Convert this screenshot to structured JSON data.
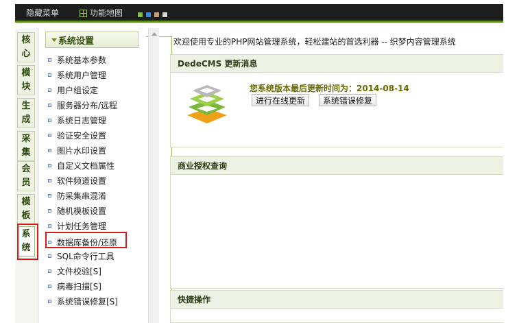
{
  "topbar": {
    "hide_menu_label": "隐藏菜单",
    "site_map_label": "功能地图",
    "skin_colors": [
      "#7bc142",
      "#3a8bd6",
      "#c8a070",
      "#d8d8d8"
    ]
  },
  "vtabs": [
    {
      "label1": "核",
      "label2": "心"
    },
    {
      "label1": "模",
      "label2": "块"
    },
    {
      "label1": "生",
      "label2": "成"
    },
    {
      "label1": "采",
      "label2": "集"
    },
    {
      "label1": "会",
      "label2": "员"
    },
    {
      "label1": "模",
      "label2": "板"
    },
    {
      "label1": "系",
      "label2": "统"
    }
  ],
  "menu": {
    "title": "系统设置",
    "items": [
      "系统基本参数",
      "系统用户管理",
      "用户组设定",
      "服务器分布/远程",
      "系统日志管理",
      "验证安全设置",
      "图片水印设置",
      "自定义文档属性",
      "软件频道设置",
      "防采集串混淆",
      "随机模板设置",
      "计划任务管理",
      "数据库备份/还原",
      "SQL命令行工具",
      "文件校验[S]",
      "病毒扫描[S]",
      "系统错误修复[S]"
    ]
  },
  "main": {
    "welcome": "欢迎使用专业的PHP网站管理系统，轻松建站的首选利器 -- 织梦内容管理系统",
    "update_panel": {
      "title": "DedeCMS 更新消息",
      "version_text": "您系统版本最后更新时间为：2014-08-14",
      "btn_online_update": "进行在线更新",
      "btn_fix": "系统错误修复"
    },
    "license_panel": {
      "title": "商业授权查询"
    },
    "quick_panel": {
      "title": "快捷操作"
    }
  }
}
